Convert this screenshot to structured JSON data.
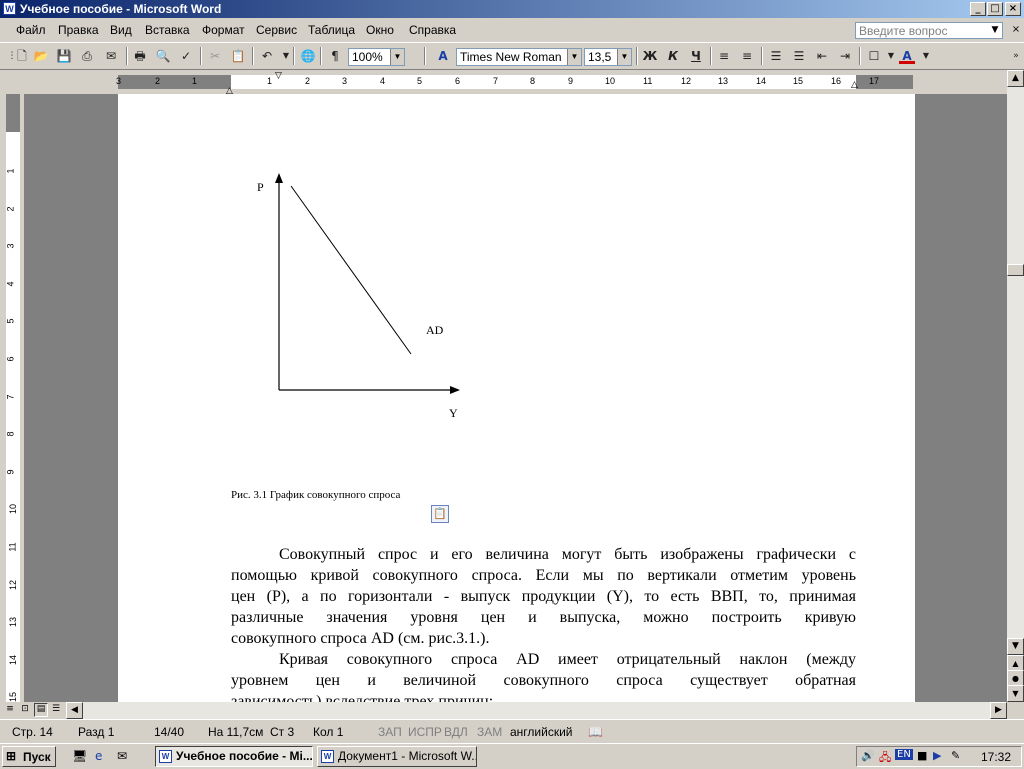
{
  "window": {
    "title": "Учебное пособие - Microsoft Word",
    "controls": {
      "minimize": "_",
      "maximize": "□",
      "close": "×"
    }
  },
  "menu": {
    "items": [
      "Файл",
      "Правка",
      "Вид",
      "Вставка",
      "Формат",
      "Сервис",
      "Таблица",
      "Окно",
      "Справка"
    ],
    "help_placeholder": "Введите вопрос"
  },
  "toolbar": {
    "zoom": "100%",
    "font": "Times New Roman",
    "font_size": "13,5",
    "bold": "Ж",
    "italic": "К",
    "underline": "Ч",
    "pilcrow": "¶",
    "font_color_letter": "A"
  },
  "ruler": {
    "left_numbers": [
      "3",
      "2",
      "1"
    ],
    "numbers": [
      "1",
      "2",
      "3",
      "4",
      "5",
      "6",
      "7",
      "8",
      "9",
      "10",
      "11",
      "12",
      "13",
      "14",
      "15",
      "16",
      "17"
    ],
    "vertical_numbers": [
      "1",
      "2",
      "3",
      "4",
      "5",
      "6",
      "7",
      "8",
      "9",
      "10",
      "11",
      "12",
      "13",
      "14",
      "15"
    ]
  },
  "figure": {
    "p_label": "P",
    "ad_label": "AD",
    "y_label": "Y",
    "caption": "Рис. 3.1 График совокупного спроса"
  },
  "body_text": {
    "p1": [
      "Совокупный спрос и его величина могут быть изображены графически с",
      "помощью кривой совокупного спроса. Если мы по вертикали отметим уровень",
      "цен (P), а по горизонтали - выпуск продукции (Y), то есть ВВП, то, принимая",
      "различные   значения уровня цен и выпуска, можно построить кривую",
      "совокупного спроса AD (см. рис.3.1.)."
    ],
    "p2": [
      "Кривая совокупного спроса AD имеет  отрицательный наклон (между",
      "уровнем    цен и величиной совокупного спроса существует обратная",
      "зависимость) вследствие трех причин:"
    ]
  },
  "status": {
    "page": "Стр. 14",
    "section": "Разд 1",
    "pages": "14/40",
    "position": "На 11,7см",
    "line": "Ст 3",
    "column": "Кол 1",
    "rec": "ЗАП",
    "trk": "ИСПР",
    "ext": "ВДЛ",
    "ovr": "ЗАМ",
    "language": "английский"
  },
  "taskbar": {
    "start": "Пуск",
    "tasks": [
      "Учебное пособие - Mi...",
      "Документ1 - Microsoft W..."
    ],
    "lang": "EN",
    "clock": "17:32"
  }
}
